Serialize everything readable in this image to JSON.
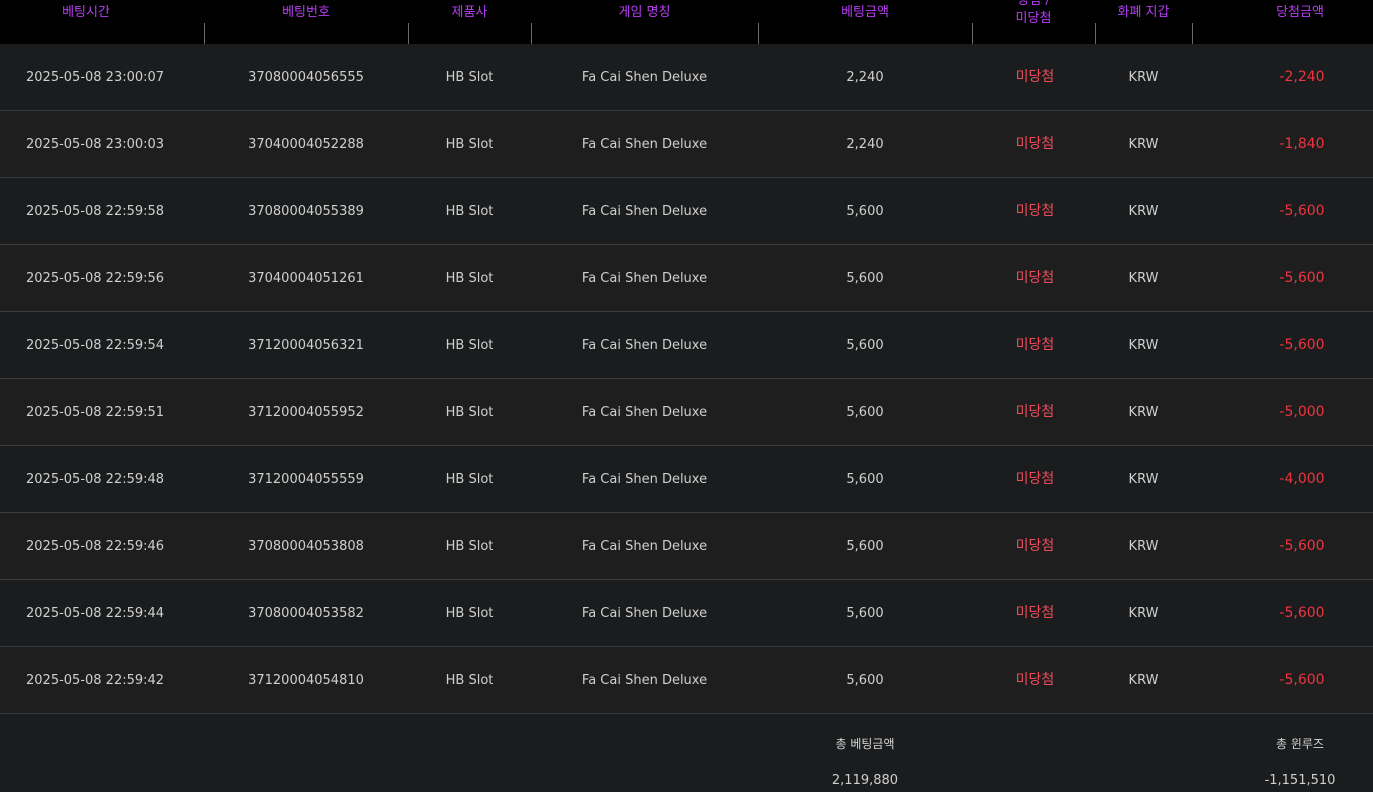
{
  "columns": [
    {
      "label": "베팅시간"
    },
    {
      "label": "베팅번호"
    },
    {
      "label": "제품사"
    },
    {
      "label": "게임 명칭"
    },
    {
      "label": "베팅금액"
    },
    {
      "label_line1": "당첨 /",
      "label_line2": "미당첨"
    },
    {
      "label": "화폐 지갑"
    },
    {
      "label": "당첨금액"
    }
  ],
  "rows": [
    {
      "time": "2025-05-08 23:00:07",
      "bet_no": "37080004056555",
      "provider": "HB Slot",
      "game": "Fa Cai Shen Deluxe",
      "amount": "2,240",
      "status": "미당첨",
      "currency": "KRW",
      "win": "-2,240"
    },
    {
      "time": "2025-05-08 23:00:03",
      "bet_no": "37040004052288",
      "provider": "HB Slot",
      "game": "Fa Cai Shen Deluxe",
      "amount": "2,240",
      "status": "미당첨",
      "currency": "KRW",
      "win": "-1,840"
    },
    {
      "time": "2025-05-08 22:59:58",
      "bet_no": "37080004055389",
      "provider": "HB Slot",
      "game": "Fa Cai Shen Deluxe",
      "amount": "5,600",
      "status": "미당첨",
      "currency": "KRW",
      "win": "-5,600"
    },
    {
      "time": "2025-05-08 22:59:56",
      "bet_no": "37040004051261",
      "provider": "HB Slot",
      "game": "Fa Cai Shen Deluxe",
      "amount": "5,600",
      "status": "미당첨",
      "currency": "KRW",
      "win": "-5,600"
    },
    {
      "time": "2025-05-08 22:59:54",
      "bet_no": "37120004056321",
      "provider": "HB Slot",
      "game": "Fa Cai Shen Deluxe",
      "amount": "5,600",
      "status": "미당첨",
      "currency": "KRW",
      "win": "-5,600"
    },
    {
      "time": "2025-05-08 22:59:51",
      "bet_no": "37120004055952",
      "provider": "HB Slot",
      "game": "Fa Cai Shen Deluxe",
      "amount": "5,600",
      "status": "미당첨",
      "currency": "KRW",
      "win": "-5,000"
    },
    {
      "time": "2025-05-08 22:59:48",
      "bet_no": "37120004055559",
      "provider": "HB Slot",
      "game": "Fa Cai Shen Deluxe",
      "amount": "5,600",
      "status": "미당첨",
      "currency": "KRW",
      "win": "-4,000"
    },
    {
      "time": "2025-05-08 22:59:46",
      "bet_no": "37080004053808",
      "provider": "HB Slot",
      "game": "Fa Cai Shen Deluxe",
      "amount": "5,600",
      "status": "미당첨",
      "currency": "KRW",
      "win": "-5,600"
    },
    {
      "time": "2025-05-08 22:59:44",
      "bet_no": "37080004053582",
      "provider": "HB Slot",
      "game": "Fa Cai Shen Deluxe",
      "amount": "5,600",
      "status": "미당첨",
      "currency": "KRW",
      "win": "-5,600"
    },
    {
      "time": "2025-05-08 22:59:42",
      "bet_no": "37120004054810",
      "provider": "HB Slot",
      "game": "Fa Cai Shen Deluxe",
      "amount": "5,600",
      "status": "미당첨",
      "currency": "KRW",
      "win": "-5,600"
    }
  ],
  "summary": {
    "total_bet_label": "총 베팅금액",
    "total_bet_value": "2,119,880",
    "total_winloss_label": "총 윈루즈",
    "total_winloss_value": "-1,151,510"
  },
  "colors": {
    "header_text": "#b83df5",
    "loss_text": "#f0343f",
    "status_text": "#f04d5b"
  }
}
